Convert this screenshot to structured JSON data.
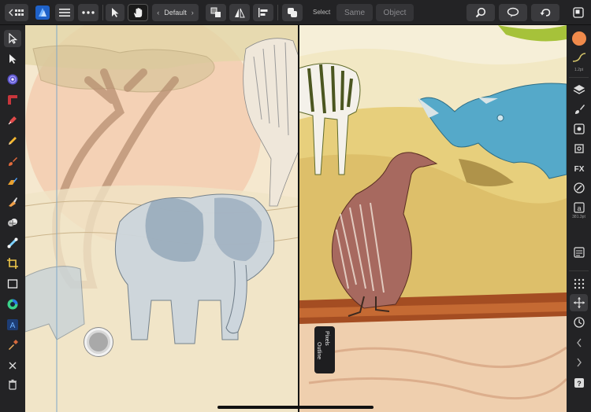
{
  "toolbar": {
    "persona_icon": "documents-persona-icon",
    "style_preset": "Default",
    "select_label": "Select",
    "same_label": "Same",
    "object_label": "Object"
  },
  "split_view": {
    "left_mode": "Outline",
    "right_mode": "Pixels"
  },
  "right_panel": {
    "stroke_caption": "1.2pt",
    "text_size_caption": "381.3pt"
  },
  "colors": {
    "accent": "#f08a4b",
    "brand": "#2a7be4",
    "panel_bg": "#232325"
  }
}
